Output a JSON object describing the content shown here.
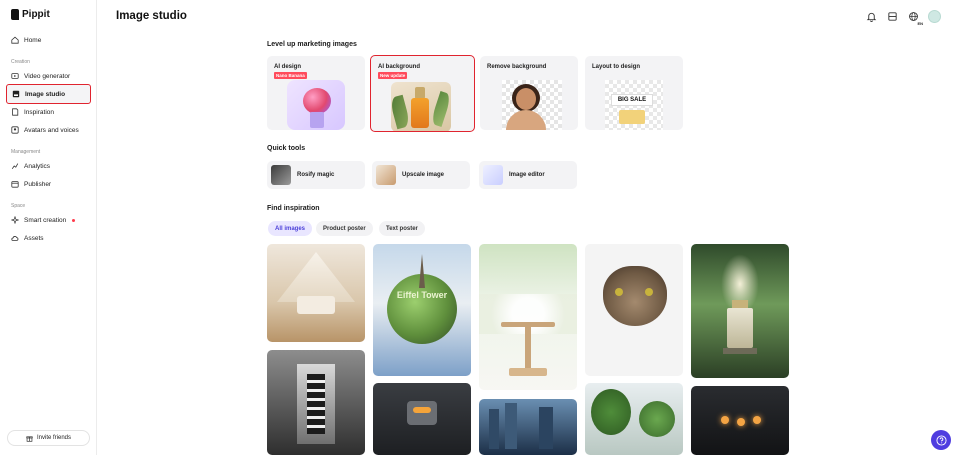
{
  "app": {
    "name": "Pippit"
  },
  "sidebar": {
    "home": "Home",
    "sections": {
      "creation": "Creation",
      "management": "Management",
      "space": "Space"
    },
    "items": {
      "video_generator": "Video generator",
      "image_studio": "Image studio",
      "inspiration": "Inspiration",
      "avatars_voices": "Avatars and voices",
      "analytics": "Analytics",
      "publisher": "Publisher",
      "smart_creation": "Smart creation",
      "assets": "Assets"
    },
    "invite": "Invite friends"
  },
  "header": {
    "title": "Image studio",
    "lang": "EN"
  },
  "marketing": {
    "heading": "Level up marketing images",
    "cards": [
      {
        "title": "AI design",
        "badge": "Nano Banana"
      },
      {
        "title": "AI background",
        "badge": "New update"
      },
      {
        "title": "Remove background",
        "badge": ""
      },
      {
        "title": "Layout to design",
        "badge": "",
        "art_text": "BIG SALE"
      }
    ]
  },
  "quick_tools": {
    "heading": "Quick tools",
    "items": [
      {
        "label": "Rosify magic"
      },
      {
        "label": "Upscale image"
      },
      {
        "label": "Image editor"
      }
    ]
  },
  "inspiration": {
    "heading": "Find inspiration",
    "filters": [
      "All images",
      "Product poster",
      "Text poster"
    ],
    "active_filter": "All images",
    "globe_text": "Eiffel Tower"
  },
  "colors": {
    "accent": "#4f3de0",
    "highlight": "#e0242f",
    "badge": "#ff4b5c"
  }
}
